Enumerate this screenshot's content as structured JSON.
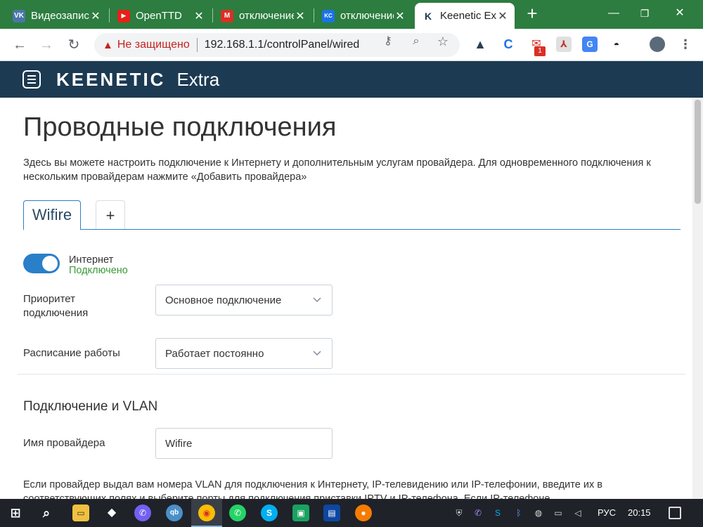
{
  "browser": {
    "tabs": [
      {
        "title": "Видеозаписи",
        "favicon": "vk-icon",
        "color": "#4a76a8",
        "glyph": "VK"
      },
      {
        "title": "OpenTTD",
        "favicon": "youtube-icon",
        "color": "#e62117",
        "glyph": "▶"
      },
      {
        "title": "отключение",
        "favicon": "gmail-icon",
        "color": "#d93025",
        "glyph": "M"
      },
      {
        "title": "отключение",
        "favicon": "kc-icon",
        "color": "#1a73e8",
        "glyph": "KC"
      },
      {
        "title": "Keenetic Extra",
        "favicon": "keenetic-icon",
        "color": "#1c3a52",
        "glyph": "K"
      }
    ],
    "active_tab": 4,
    "security_label": "Не защищено",
    "url": "192.168.1.1/controlPanel/wired",
    "tab_strip_color": "#2c7d3f",
    "extension_badge": "1"
  },
  "app": {
    "brand": "KEENETIC",
    "model": "Extra",
    "header_color": "#1c3a52",
    "accent_color": "#2a7fc9"
  },
  "page": {
    "title": "Проводные подключения",
    "description": "Здесь вы можете настроить подключение к Интернету и дополнительным услугам провайдера. Для одновременного подключения к нескольким провайдерам нажмите «Добавить провайдера»",
    "tabs": [
      {
        "label": "Wifire"
      },
      {
        "label": "+"
      }
    ],
    "internet": {
      "label": "Интернет",
      "status": "Подключено",
      "enabled": true,
      "status_color": "#3a9a3a"
    },
    "priority": {
      "label": "Приоритет подключения",
      "value": "Основное подключение"
    },
    "schedule": {
      "label": "Расписание работы",
      "value": "Работает постоянно"
    },
    "vlan_section": {
      "title": "Подключение и VLAN",
      "provider_label": "Имя провайдера",
      "provider_value": "Wifire",
      "description": "Если провайдер выдал вам номера VLAN для подключения к Интернету, IP-телевидению или IP-телефонии, введите их в соответствующих полях и выберите порты для подключения приставки IPTV и IP-телефона. Если IP-телефоне"
    }
  },
  "taskbar": {
    "language": "РУС",
    "time": "20:15"
  }
}
